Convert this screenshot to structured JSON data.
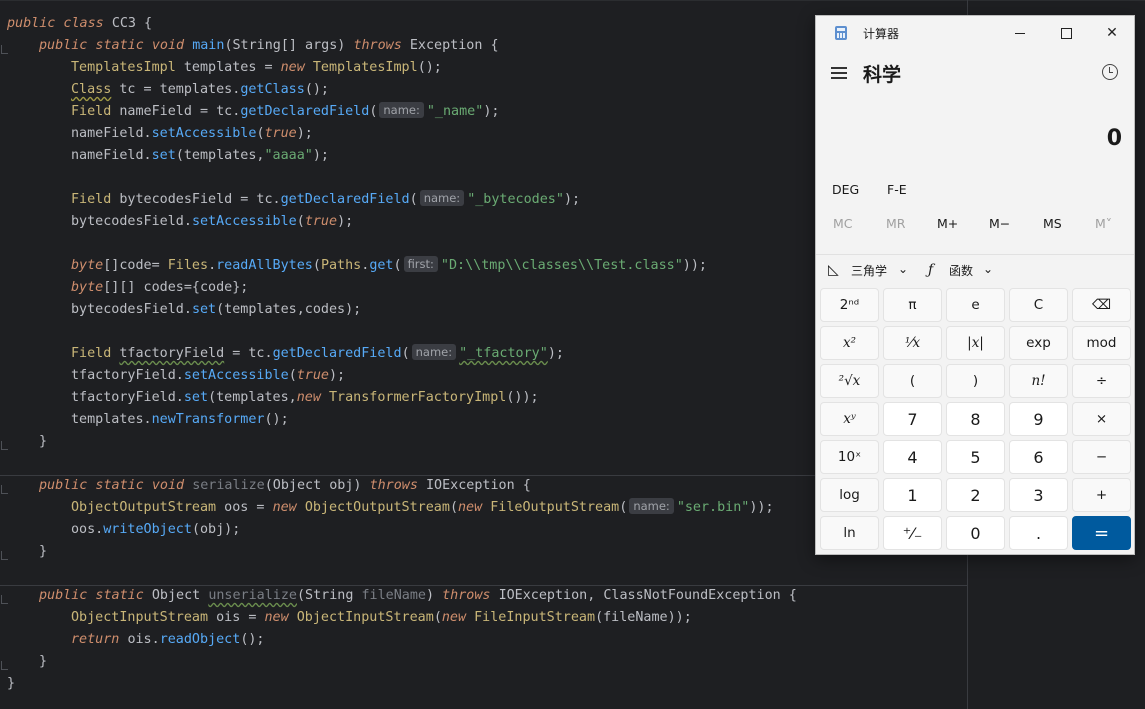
{
  "editor": {
    "lines": [
      "CC3_CLASS",
      "main_sig",
      "line_tpl",
      "line_tc",
      "line_namefield",
      "line_setacc",
      "line_set",
      "",
      "line_bytecodesfield",
      "line_setacc2",
      "",
      "line_code",
      "line_codes",
      "line_set2",
      "",
      "line_tfactory",
      "line_setacc3",
      "line_set3",
      "line_newtrans",
      "close1"
    ],
    "code_text": {
      "class_decl": "public class CC3 {",
      "main": "public static void main(String[] args) throws Exception {",
      "tpl": "TemplatesImpl templates = new TemplatesImpl();",
      "tc": "Class tc = templates.getClass();",
      "nameField": "Field nameField = tc.getDeclaredField(",
      "hint_name": "name:",
      "hint_first": "first:",
      "str_name": "\"_name\"",
      "str_aaaa": "\"aaaa\"",
      "str_bytecodes": "\"_bytecodes\"",
      "str_path": "\"D:\\\\tmp\\\\classes\\\\Test.class\"",
      "str_tfactory": "\"_tfactory\"",
      "str_serbin": "\"ser.bin\""
    }
  },
  "calculator": {
    "app_title": "计算器",
    "mode_title": "科学",
    "display_value": "0",
    "angle_unit": "DEG",
    "fe_label": "F-E",
    "memory": [
      "MC",
      "MR",
      "M+",
      "M−",
      "MS",
      "M˅"
    ],
    "trig_label": "三角学",
    "func_label": "函数",
    "keys": [
      "2ⁿᵈ",
      "π",
      "e",
      "C",
      "⌫",
      "x²",
      "¹⁄x",
      "|x|",
      "exp",
      "mod",
      "²√x",
      "(",
      ")",
      "n!",
      "÷",
      "xʸ",
      "7",
      "8",
      "9",
      "×",
      "10ˣ",
      "4",
      "5",
      "6",
      "−",
      "log",
      "1",
      "2",
      "3",
      "+",
      "ln",
      "⁺⁄₋",
      "0",
      ".",
      "="
    ],
    "colors": {
      "accent": "#005a9e",
      "background": "#f3f3f3"
    }
  }
}
